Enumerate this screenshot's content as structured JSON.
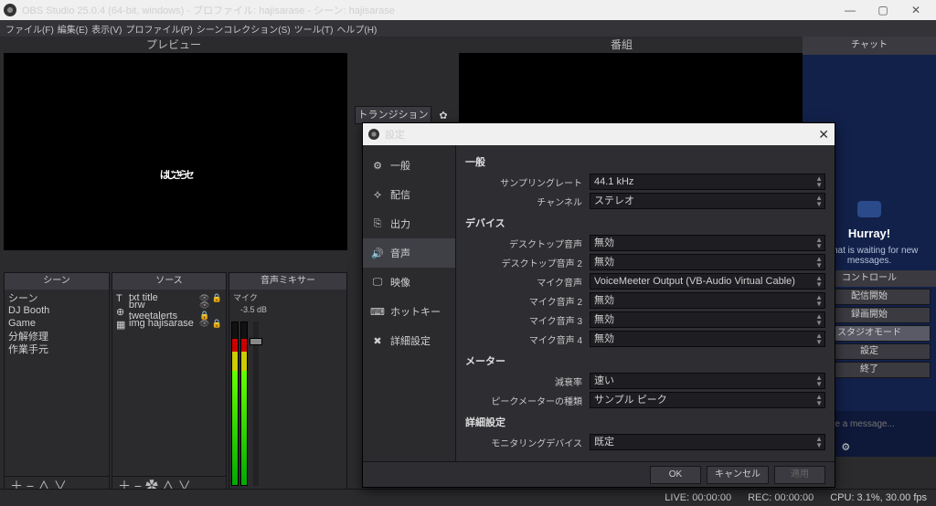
{
  "titlebar": {
    "text": "OBS Studio 25.0.4 (64-bit, windows) - プロファイル: hajisarase - シーン: hajisarase"
  },
  "menu": {
    "items": [
      "ファイル(F)",
      "編集(E)",
      "表示(V)",
      "プロファイル(P)",
      "シーンコレクション(S)",
      "ツール(T)",
      "ヘルプ(H)"
    ]
  },
  "preview": {
    "left_label": "プレビュー",
    "right_label": "番組"
  },
  "transition": {
    "label": "トランジション"
  },
  "scenes": {
    "head": "シーン",
    "items": [
      "シーン",
      "DJ Booth",
      "Game",
      "分解修理",
      "作業手元"
    ],
    "tools": "＋ − ∧ ∨"
  },
  "sources": {
    "head": "ソース",
    "items": [
      {
        "ico": "T",
        "label": "txt title"
      },
      {
        "ico": "⊕",
        "label": "brw tweetalerts"
      },
      {
        "ico": "▦",
        "label": "img hajisarase"
      }
    ],
    "tools": "＋ − ✿ ∧ ∨"
  },
  "mixer": {
    "head": "音声ミキサー",
    "mic_label": "マイク",
    "mic_db": "-3.5 dB"
  },
  "chat": {
    "head": "チャット",
    "title": "Hurray!",
    "body": "e chat is waiting for new messages.",
    "placeholder": "Type a message..."
  },
  "controls": {
    "head": "コントロール",
    "btns": [
      "配信開始",
      "録画開始",
      "スタジオモード",
      "設定",
      "終了"
    ],
    "active_idx": 2
  },
  "status": {
    "live": "LIVE: 00:00:00",
    "rec": "REC: 00:00:00",
    "cpu": "CPU: 3.1%, 30.00 fps"
  },
  "dialog": {
    "title": "設定",
    "nav": [
      "一般",
      "配信",
      "出力",
      "音声",
      "映像",
      "ホットキー",
      "詳細設定"
    ],
    "nav_sel": 3,
    "sections": {
      "general": {
        "head": "一般",
        "rows": [
          {
            "lab": "サンプリングレート",
            "val": "44.1 kHz"
          },
          {
            "lab": "チャンネル",
            "val": "ステレオ"
          }
        ]
      },
      "device": {
        "head": "デバイス",
        "rows": [
          {
            "lab": "デスクトップ音声",
            "val": "無効"
          },
          {
            "lab": "デスクトップ音声 2",
            "val": "無効"
          },
          {
            "lab": "マイク音声",
            "val": "VoiceMeeter Output (VB-Audio Virtual Cable)"
          },
          {
            "lab": "マイク音声 2",
            "val": "無効"
          },
          {
            "lab": "マイク音声 3",
            "val": "無効"
          },
          {
            "lab": "マイク音声 4",
            "val": "無効"
          }
        ]
      },
      "meter": {
        "head": "メーター",
        "rows": [
          {
            "lab": "減衰率",
            "val": "速い"
          },
          {
            "lab": "ピークメーターの種類",
            "val": "サンプル ピーク"
          }
        ]
      },
      "adv": {
        "head": "詳細設定",
        "rows": [
          {
            "lab": "モニタリングデバイス",
            "val": "既定"
          }
        ]
      }
    },
    "btns": {
      "ok": "OK",
      "cancel": "キャンセル",
      "apply": "適用"
    }
  }
}
